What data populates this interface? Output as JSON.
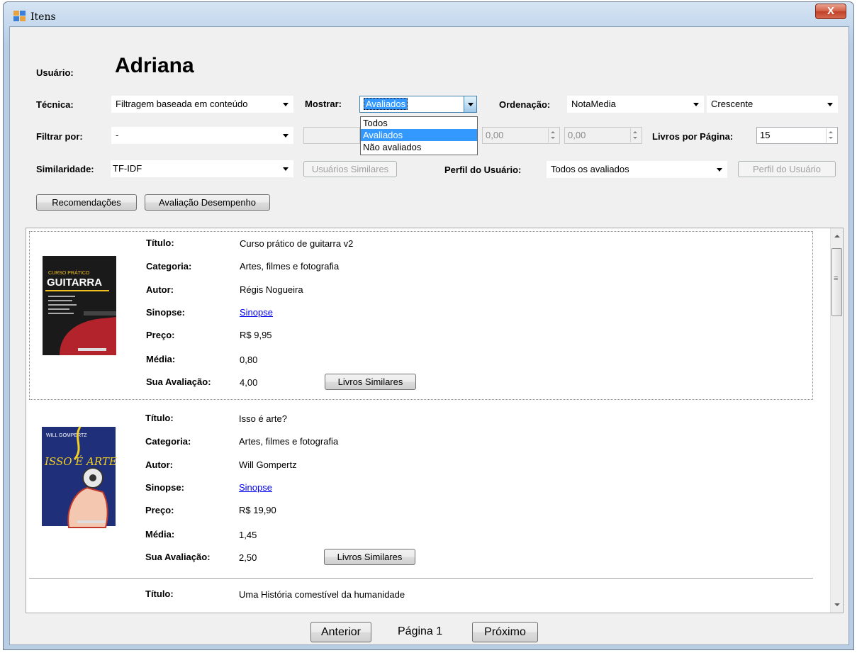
{
  "window": {
    "title": "Itens",
    "close": "X"
  },
  "user": {
    "label": "Usuário:",
    "name": "Adriana"
  },
  "controls": {
    "tecnica": {
      "label": "Técnica:",
      "value": "Filtragem baseada em conteúdo"
    },
    "mostrar": {
      "label": "Mostrar:",
      "value": "Avaliados",
      "options": [
        "Todos",
        "Avaliados",
        "Não avaliados"
      ]
    },
    "ordenacao": {
      "label": "Ordenação:",
      "value": "NotaMedia",
      "direction": "Crescente"
    },
    "filtrar": {
      "label": "Filtrar por:",
      "value": "-"
    },
    "range_min": "0,00",
    "range_max": "0,00",
    "livros_por_pagina": {
      "label": "Livros por Página:",
      "value": "15"
    },
    "similaridade": {
      "label": "Similaridade:",
      "value": "TF-IDF"
    },
    "usuarios_similares": "Usuários Similares",
    "perfil": {
      "label": "Perfil do Usuário:",
      "value": "Todos os avaliados",
      "button": "Perfil do Usuário"
    },
    "recomendacoes": "Recomendações",
    "avaliacao_desempenho": "Avaliação Desempenho"
  },
  "field_labels": {
    "titulo": "Título:",
    "categoria": "Categoria:",
    "autor": "Autor:",
    "sinopse": "Sinopse:",
    "preco": "Preço:",
    "media": "Média:",
    "sua_avaliacao": "Sua Avaliação:"
  },
  "items": [
    {
      "titulo": "Curso prático de guitarra v2",
      "categoria": "Artes, filmes e fotografia",
      "autor": "Régis Nogueira",
      "sinopse": "Sinopse",
      "preco": "R$ 9,95",
      "media": "0,80",
      "sua_avaliacao": "4,00",
      "similar_button": "Livros Similares",
      "cover_text": "GUITARRA"
    },
    {
      "titulo": "Isso é arte?",
      "categoria": "Artes, filmes e fotografia",
      "autor": "Will Gompertz",
      "sinopse": "Sinopse",
      "preco": "R$ 19,90",
      "media": "1,45",
      "sua_avaliacao": "2,50",
      "similar_button": "Livros Similares",
      "cover_text": "ISSO É ARTE ?"
    },
    {
      "titulo": "Uma História comestível da humanidade"
    }
  ],
  "pagination": {
    "prev": "Anterior",
    "page": "Página 1",
    "next": "Próximo"
  }
}
